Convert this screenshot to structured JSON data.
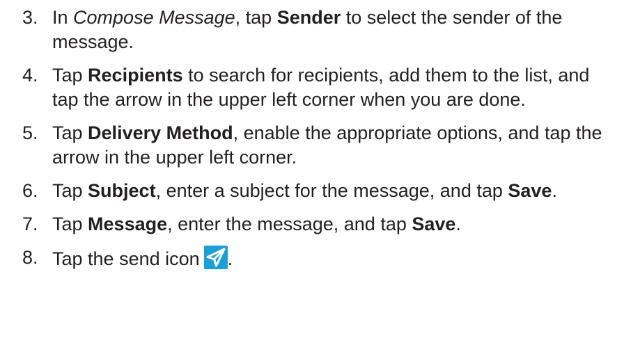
{
  "steps": [
    {
      "number": "3.",
      "parts": [
        {
          "t": "In "
        },
        {
          "t": "Compose Message",
          "s": "i"
        },
        {
          "t": ", tap "
        },
        {
          "t": "Sender",
          "s": "b"
        },
        {
          "t": " to select the sender of the message."
        }
      ]
    },
    {
      "number": "4.",
      "parts": [
        {
          "t": "Tap "
        },
        {
          "t": "Recipients",
          "s": "b"
        },
        {
          "t": " to search for recipients, add them to the list, and tap the arrow in the upper left corner when you are done."
        }
      ]
    },
    {
      "number": "5.",
      "parts": [
        {
          "t": "Tap "
        },
        {
          "t": "Delivery Method",
          "s": "b"
        },
        {
          "t": ", enable the appropriate options, and tap the arrow in the upper left corner."
        }
      ]
    },
    {
      "number": "6.",
      "parts": [
        {
          "t": "Tap "
        },
        {
          "t": "Subject",
          "s": "b"
        },
        {
          "t": ", enter a subject for the message, and tap "
        },
        {
          "t": "Save",
          "s": "b"
        },
        {
          "t": "."
        }
      ]
    },
    {
      "number": "7.",
      "parts": [
        {
          "t": "Tap "
        },
        {
          "t": "Message",
          "s": "b"
        },
        {
          "t": ", enter the message, and tap "
        },
        {
          "t": "Save",
          "s": "b"
        },
        {
          "t": "."
        }
      ]
    },
    {
      "number": "8.",
      "parts": [
        {
          "t": "Tap the send icon"
        },
        {
          "icon": "send-icon"
        },
        {
          "t": "."
        }
      ]
    }
  ],
  "colors": {
    "text": "#231f20",
    "icon_bg": "#1a9fd9",
    "icon_fg": "#ffffff"
  }
}
